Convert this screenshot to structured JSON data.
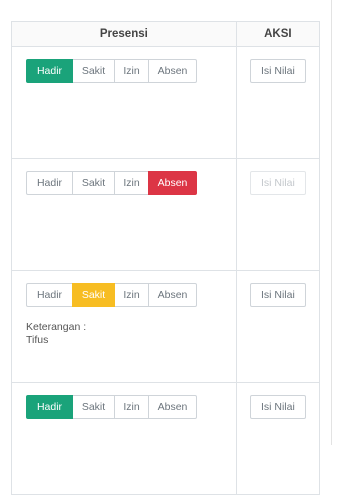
{
  "table": {
    "headers": {
      "presensi": "Presensi",
      "aksi": "AKSI"
    },
    "option_labels": {
      "hadir": "Hadir",
      "sakit": "Sakit",
      "izin": "Izin",
      "absen": "Absen"
    },
    "keterangan_label": "Keterangan :",
    "action_label": "Isi Nilai",
    "rows": [
      {
        "selected": "hadir",
        "keterangan": "",
        "action_enabled": true
      },
      {
        "selected": "absen",
        "keterangan": "",
        "action_enabled": false
      },
      {
        "selected": "sakit",
        "keterangan": "Tifus",
        "action_enabled": true
      },
      {
        "selected": "hadir",
        "keterangan": "",
        "action_enabled": true
      }
    ]
  },
  "colors": {
    "hadir_active": "#1aa37a",
    "absen_active": "#dc3545",
    "sakit_active": "#f7bd22",
    "border": "#dee2e6"
  }
}
